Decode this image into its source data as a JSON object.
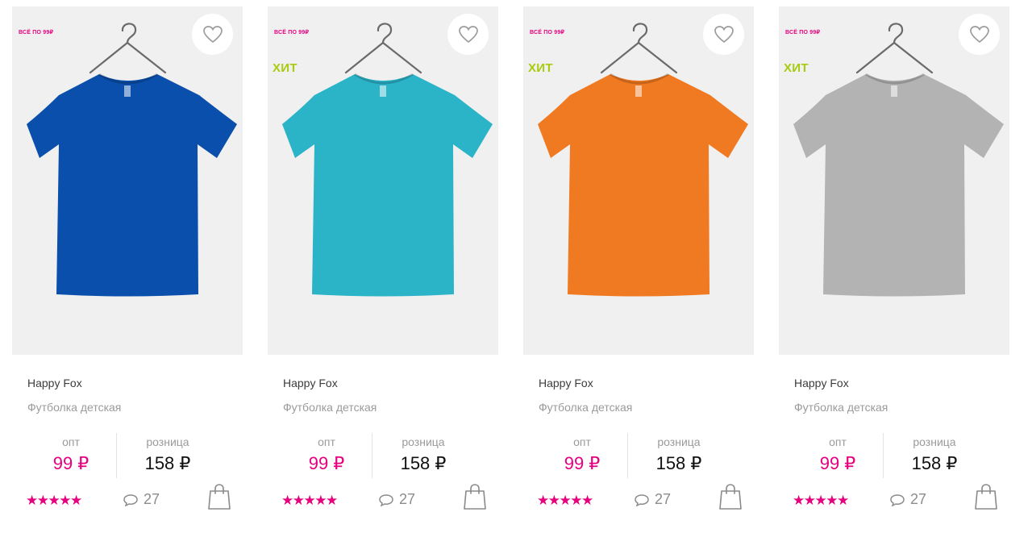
{
  "products": [
    {
      "badge_sale": "ВСЁ ПО 99₽",
      "badge_hit": "",
      "shirt_color": "#0a4fab",
      "brand": "Happy Fox",
      "title": "Футболка детская",
      "opt_label": "опт",
      "opt_price": "99 ₽",
      "retail_label": "розница",
      "retail_price": "158 ₽",
      "stars": "★★★★★",
      "rating": 5,
      "reviews": "27"
    },
    {
      "badge_sale": "ВСЁ ПО 99₽",
      "badge_hit": "ХИТ",
      "shirt_color": "#2bb3c8",
      "brand": "Happy Fox",
      "title": "Футболка детская",
      "opt_label": "опт",
      "opt_price": "99 ₽",
      "retail_label": "розница",
      "retail_price": "158 ₽",
      "stars": "★★★★★",
      "rating": 5,
      "reviews": "27"
    },
    {
      "badge_sale": "ВСЁ ПО 99₽",
      "badge_hit": "ХИТ",
      "shirt_color": "#f07a22",
      "brand": "Happy Fox",
      "title": "Футболка детская",
      "opt_label": "опт",
      "opt_price": "99 ₽",
      "retail_label": "розница",
      "retail_price": "158 ₽",
      "stars": "★★★★★",
      "rating": 5,
      "reviews": "27"
    },
    {
      "badge_sale": "ВСЁ ПО 99₽",
      "badge_hit": "ХИТ",
      "shirt_color": "#b3b3b3",
      "brand": "Happy Fox",
      "title": "Футболка детская",
      "opt_label": "опт",
      "opt_price": "99 ₽",
      "retail_label": "розница",
      "retail_price": "158 ₽",
      "stars": "★★★★★",
      "rating": 5,
      "reviews": "27"
    }
  ],
  "colors": {
    "accent_pink": "#e6007e",
    "hit_green": "#a7cc0f",
    "photo_bg": "#f1f0f0"
  },
  "icons": {
    "favorite": "heart-icon",
    "reviews": "speech-bubble-icon",
    "cart": "shopping-bag-icon",
    "rating": "star-icon"
  }
}
